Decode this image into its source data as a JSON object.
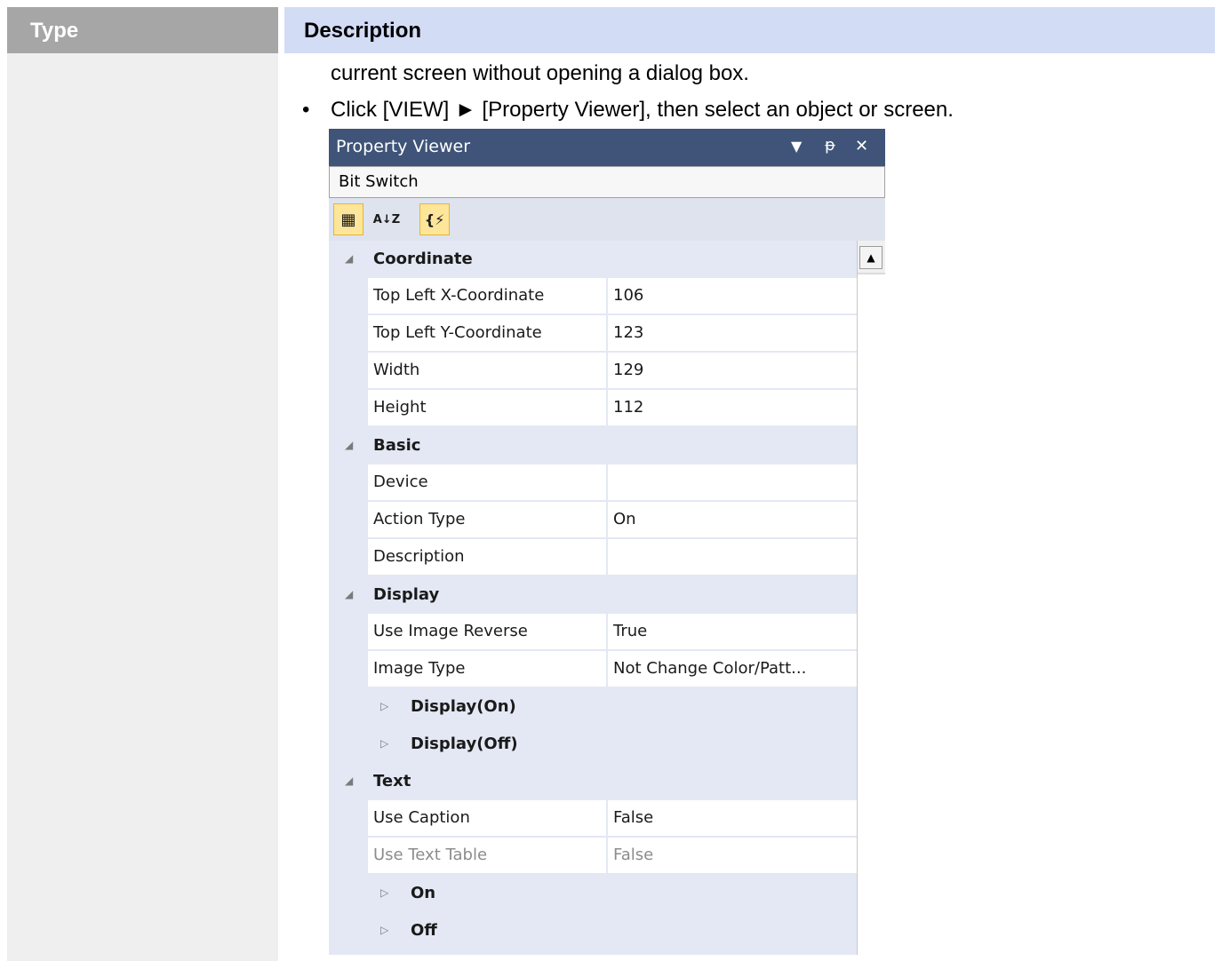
{
  "table": {
    "type_header": "Type",
    "description_header": "Description"
  },
  "description": {
    "line1": "current screen without opening a dialog box.",
    "bullet": "•",
    "line2": "Click [VIEW] ► [Property Viewer], then select an object or screen."
  },
  "property_viewer": {
    "title": "Property Viewer",
    "controls": {
      "dropdown": "▼",
      "pin": "ᵽ",
      "close": "✕"
    },
    "object_name": "Bit Switch",
    "toolbar": {
      "categorized": "▦",
      "alphabetical": "A↓Z",
      "events": "{⚡"
    },
    "rows": {
      "coordinate": {
        "label": "Coordinate"
      },
      "top_left_x": {
        "name": "Top Left X-Coordinate",
        "value": "106"
      },
      "top_left_y": {
        "name": "Top Left Y-Coordinate",
        "value": "123"
      },
      "width": {
        "name": "Width",
        "value": "129"
      },
      "height": {
        "name": "Height",
        "value": "112"
      },
      "basic": {
        "label": "Basic"
      },
      "device": {
        "name": "Device",
        "value": ""
      },
      "action_type": {
        "name": "Action Type",
        "value": "On"
      },
      "description": {
        "name": "Description",
        "value": ""
      },
      "display": {
        "label": "Display"
      },
      "use_image_reverse": {
        "name": "Use Image Reverse",
        "value": "True"
      },
      "image_type": {
        "name": "Image Type",
        "value": "Not Change Color/Patt..."
      },
      "display_on": {
        "label": "Display(On)"
      },
      "display_off": {
        "label": "Display(Off)"
      },
      "text": {
        "label": "Text"
      },
      "use_caption": {
        "name": "Use Caption",
        "value": "False"
      },
      "use_text_table": {
        "name": "Use Text Table",
        "value": "False"
      },
      "on": {
        "label": "On"
      },
      "off": {
        "label": "Off"
      }
    }
  }
}
